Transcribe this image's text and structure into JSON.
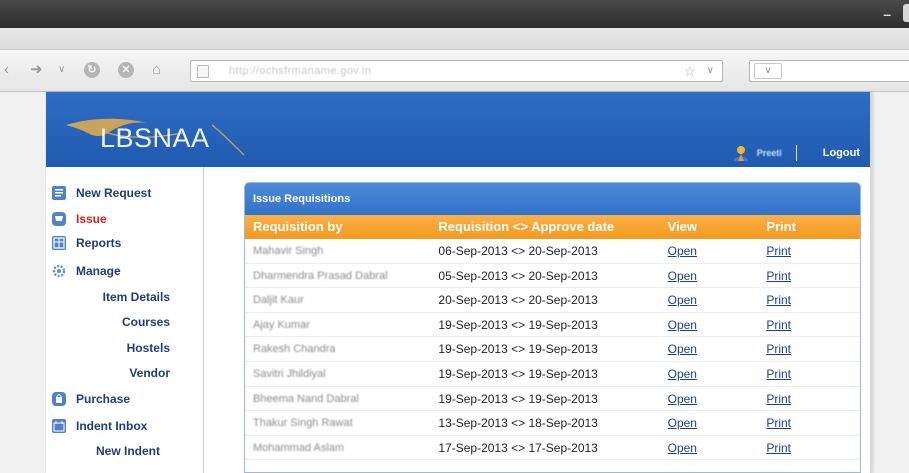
{
  "browser": {
    "url": "http://ochsfrmaname.gov.in",
    "search_engine_label": "∨",
    "minimize_label": "–"
  },
  "header": {
    "logo_text": "LBSNAA",
    "user_name": "Preeti",
    "logout_label": "Logout"
  },
  "sidebar": {
    "items": [
      {
        "label": "New Request",
        "icon": "document-icon"
      },
      {
        "label": "Issue",
        "icon": "cart-icon",
        "active": true
      },
      {
        "label": "Reports",
        "icon": "report-icon"
      },
      {
        "label": "Manage",
        "icon": "gear-icon"
      },
      {
        "label": "Purchase",
        "icon": "bag-icon"
      },
      {
        "label": "Indent Inbox",
        "icon": "inbox-icon"
      }
    ],
    "sub_items": [
      "Item Details",
      "Courses",
      "Hostels",
      "Vendor"
    ],
    "new_indent_label": "New Indent"
  },
  "panel": {
    "title": "Issue Requisitions",
    "columns": [
      "Requisition by",
      "Requisition <> Approve date",
      "View",
      "Print"
    ],
    "rows": [
      {
        "by": "Mahavir Singh",
        "dates": "06-Sep-2013 <> 20-Sep-2013",
        "view": "Open",
        "print": "Print"
      },
      {
        "by": "Dharmendra Prasad Dabral",
        "dates": "05-Sep-2013 <> 20-Sep-2013",
        "view": "Open",
        "print": "Print"
      },
      {
        "by": "Daljit Kaur",
        "dates": "20-Sep-2013 <> 20-Sep-2013",
        "view": "Open",
        "print": "Print"
      },
      {
        "by": "Ajay Kumar",
        "dates": "19-Sep-2013 <> 19-Sep-2013",
        "view": "Open",
        "print": "Print"
      },
      {
        "by": "Rakesh Chandra",
        "dates": "19-Sep-2013 <> 19-Sep-2013",
        "view": "Open",
        "print": "Print"
      },
      {
        "by": "Savitri Jhildiyal",
        "dates": "19-Sep-2013 <> 19-Sep-2013",
        "view": "Open",
        "print": "Print"
      },
      {
        "by": "Bheema Nand Dabral",
        "dates": "19-Sep-2013 <> 19-Sep-2013",
        "view": "Open",
        "print": "Print"
      },
      {
        "by": "Thakur Singh Rawat",
        "dates": "13-Sep-2013 <> 18-Sep-2013",
        "view": "Open",
        "print": "Print"
      },
      {
        "by": "Mohammad Aslam",
        "dates": "17-Sep-2013 <> 17-Sep-2013",
        "view": "Open",
        "print": "Print"
      }
    ]
  },
  "colors": {
    "header_blue": "#2563b8",
    "table_header_orange": "#f5a02a",
    "panel_title_blue": "#3d7ed0",
    "active_red": "#d71f1f",
    "link_blue": "#1a3f9a"
  }
}
